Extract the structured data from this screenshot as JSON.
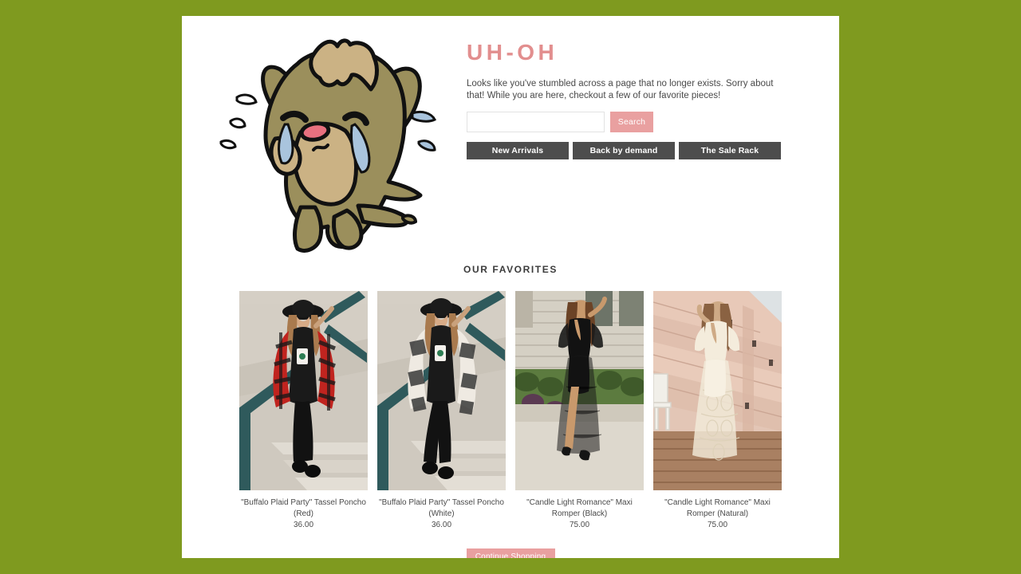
{
  "theme": {
    "background_green": "#7f9a1f",
    "card_background": "#ffffff",
    "accent_pink": "#e9a0a0",
    "heading_pink": "#e28e8e",
    "button_gray": "#4d4d4d",
    "body_text": "#4a4a4a"
  },
  "error": {
    "heading": "UH-OH",
    "message": "Looks like you've stumbled across a page that no longer exists. Sorry about that! While you are here, checkout a few of our favorite pieces!",
    "illustration": "crying-dog-illustration"
  },
  "search": {
    "value": "",
    "placeholder": "",
    "button_label": "Search"
  },
  "quick_links": [
    {
      "label": "New Arrivals"
    },
    {
      "label": "Back by demand"
    },
    {
      "label": "The Sale Rack"
    }
  ],
  "favorites": {
    "title": "OUR FAVORITES",
    "products": [
      {
        "title": "\"Buffalo Plaid Party\" Tassel Poncho (Red)",
        "price": "36.00",
        "image_alt": "model-in-red-buffalo-plaid-poncho-on-stairs"
      },
      {
        "title": "\"Buffalo Plaid Party\" Tassel Poncho (White)",
        "price": "36.00",
        "image_alt": "model-in-white-buffalo-plaid-poncho-on-stairs"
      },
      {
        "title": "\"Candle Light Romance\" Maxi Romper (Black)",
        "price": "75.00",
        "image_alt": "model-in-black-lace-maxi-romper-outdoors"
      },
      {
        "title": "\"Candle Light Romance\" Maxi Romper (Natural)",
        "price": "75.00",
        "image_alt": "model-in-cream-lace-maxi-romper-on-deck"
      }
    ]
  },
  "footer": {
    "continue_label": "Continue Shopping"
  }
}
